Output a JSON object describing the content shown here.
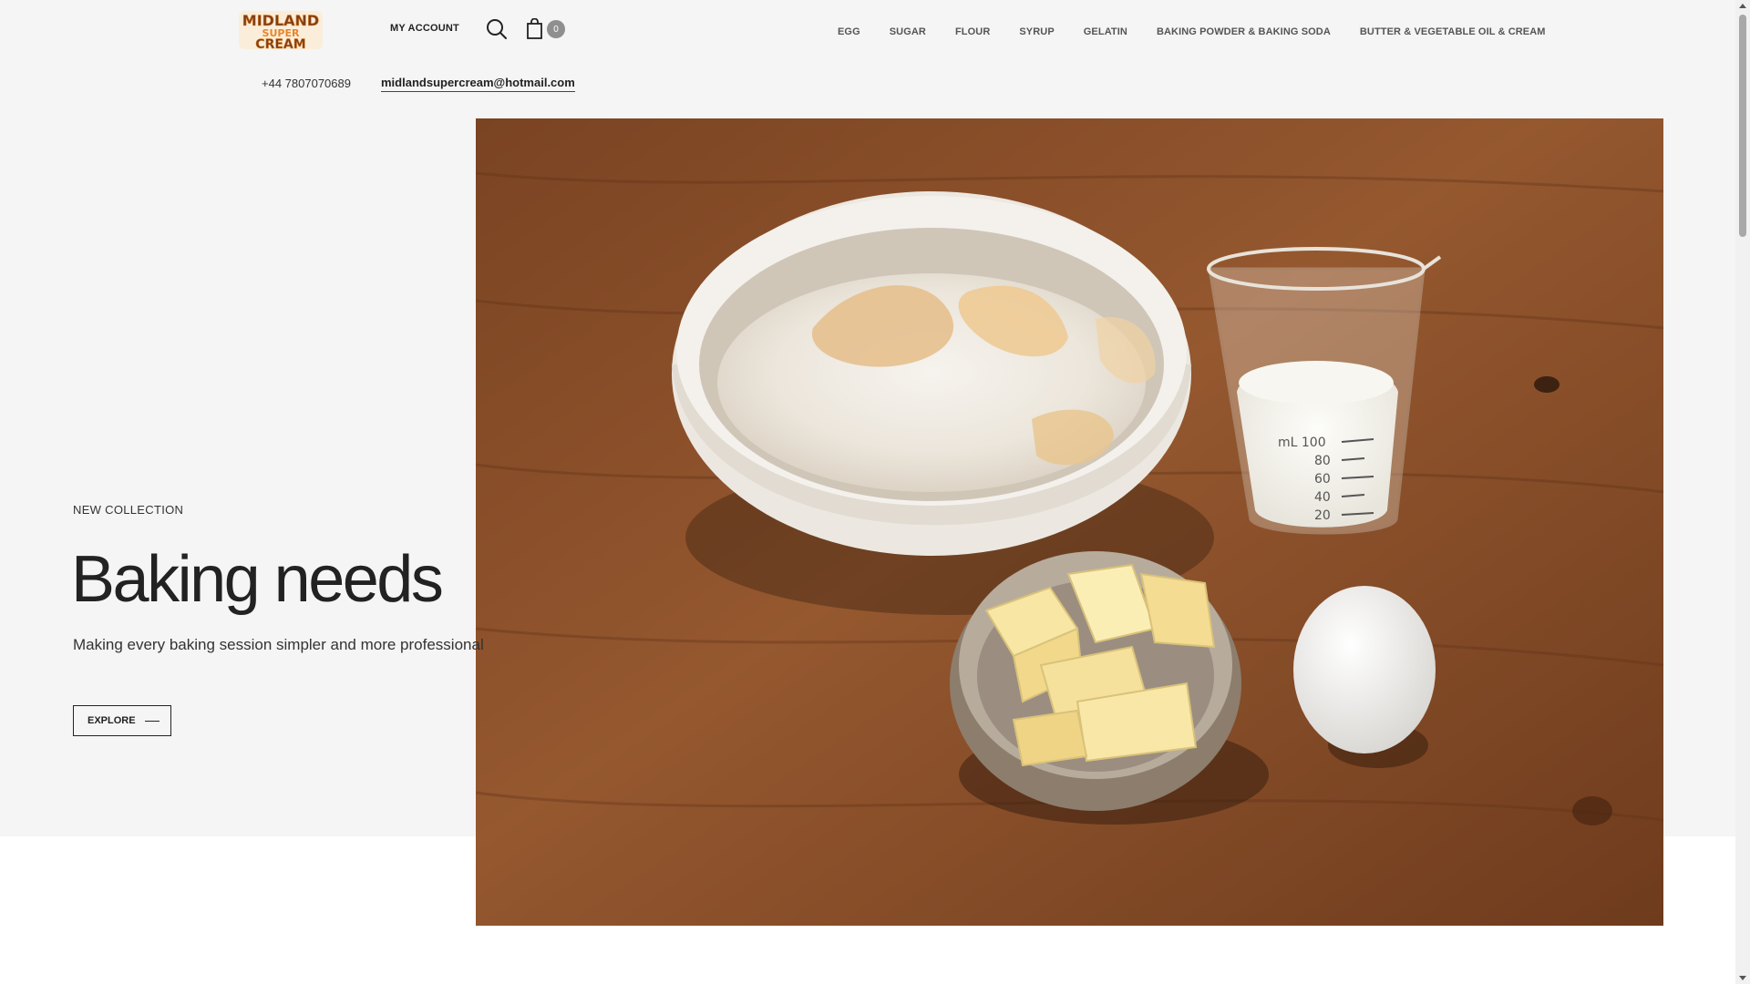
{
  "brand": {
    "logo_line1": "MIDLAND",
    "logo_line2": "SUPER",
    "logo_line3": "CREAM"
  },
  "header": {
    "account_label": "MY ACCOUNT",
    "cart_count": "0",
    "phone": "+44 7807070689",
    "email": "midlandsupercream@hotmail.com"
  },
  "nav": {
    "items": [
      "EGG",
      "SUGAR",
      "FLOUR",
      "SYRUP",
      "GELATIN",
      "BAKING POWDER & BAKING SODA",
      "BUTTER & VEGETABLE OIL & CREAM"
    ]
  },
  "hero": {
    "eyebrow": "NEW COLLECTION",
    "title": "Baking needs",
    "subtitle": "Making every baking session simpler and more professional",
    "button_label": "EXPLORE",
    "cup_markings": [
      "mL 100",
      "80",
      "60",
      "40",
      "20"
    ]
  },
  "icons": {
    "search": "search-icon",
    "cart": "shopping-bag-icon",
    "explore": "line-arrow-icon"
  },
  "colors": {
    "hero_background": "#f5f5f5",
    "logo_orange": "#e8862a",
    "logo_brown": "#6b3a1e",
    "table_wood": "#8a4e28"
  }
}
